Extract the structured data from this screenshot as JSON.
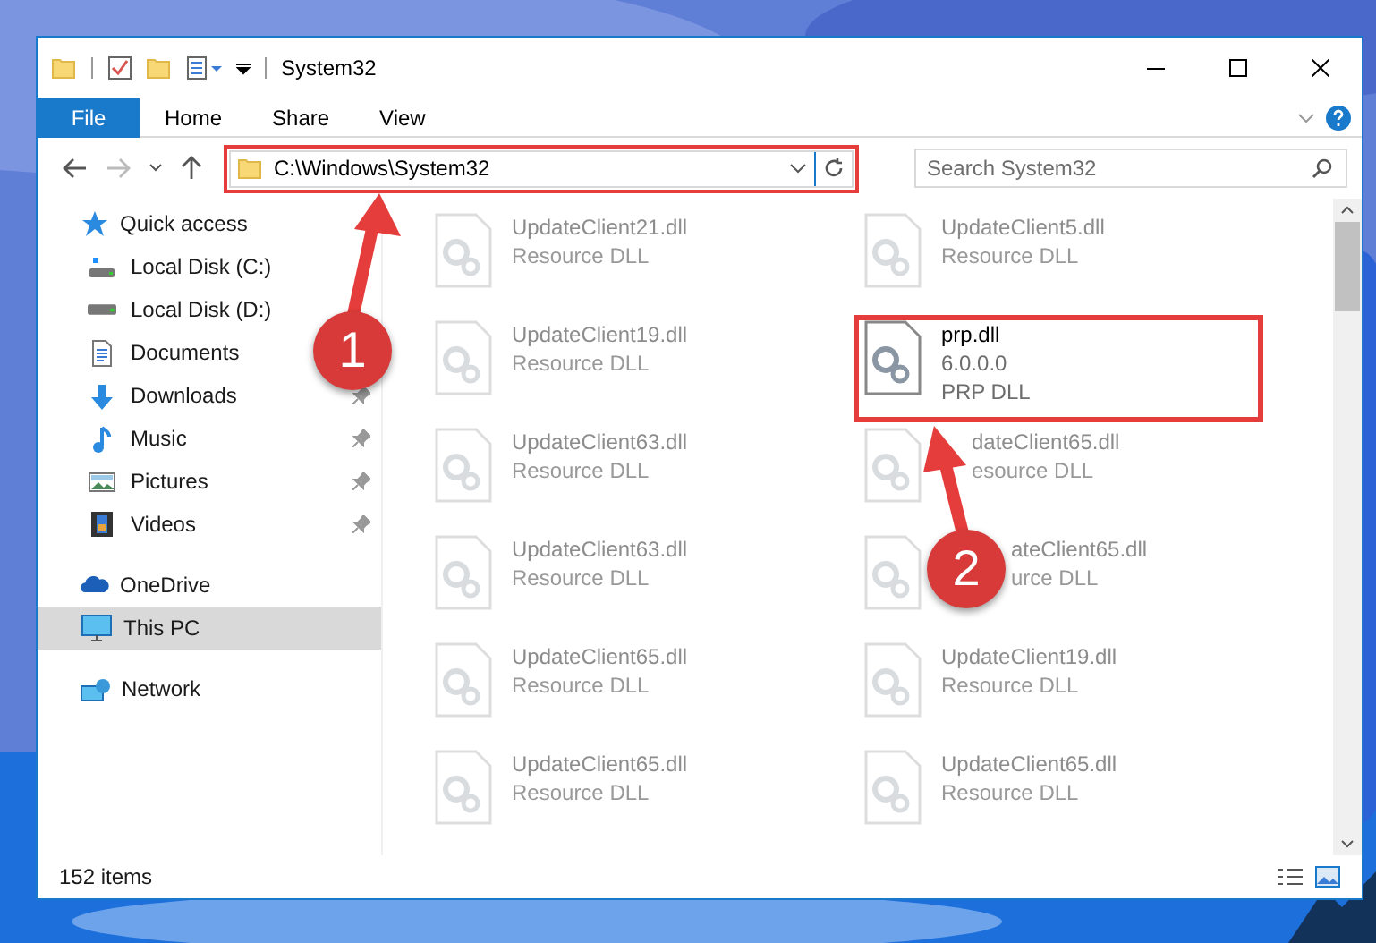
{
  "window": {
    "title": "System32"
  },
  "ribbon_tabs": [
    {
      "label": "File",
      "selected": true
    },
    {
      "label": "Home",
      "selected": false
    },
    {
      "label": "Share",
      "selected": false
    },
    {
      "label": "View",
      "selected": false
    }
  ],
  "address_bar": {
    "path": "C:\\Windows\\System32"
  },
  "search": {
    "placeholder": "Search System32"
  },
  "navigation": [
    {
      "label": "Quick access",
      "selected": false,
      "children": [
        {
          "label": "Local Disk (C:)"
        },
        {
          "label": "Local Disk (D:)"
        },
        {
          "label": "Documents"
        },
        {
          "label": "Downloads",
          "pinned": true
        },
        {
          "label": "Music",
          "pinned": true
        },
        {
          "label": "Pictures",
          "pinned": true
        },
        {
          "label": "Videos",
          "pinned": true
        }
      ]
    },
    {
      "label": "OneDrive",
      "selected": false
    },
    {
      "label": "This PC",
      "selected": true
    },
    {
      "label": "Network",
      "selected": false
    }
  ],
  "files": [
    {
      "kind": "plain",
      "name": "UpdateClient21.dll",
      "details": [
        "Resource DLL"
      ],
      "highlighted": false
    },
    {
      "kind": "plain",
      "name": "UpdateClient5.dll",
      "details": [
        "Resource DLL"
      ],
      "highlighted": false
    },
    {
      "kind": "plain",
      "name": "UpdateClient19.dll",
      "details": [
        "Resource DLL"
      ],
      "highlighted": false
    },
    {
      "kind": "plain",
      "name": "prp.dll",
      "details": [
        "6.0.0.0",
        "PRP DLL"
      ],
      "highlighted": true
    },
    {
      "kind": "plain",
      "name": "UpdateClient63.dll",
      "details": [
        "Resource DLL"
      ],
      "highlighted": false
    },
    {
      "kind": "under_arrow",
      "name": "dateClient65.dll",
      "details": [
        "esource DLL"
      ],
      "highlighted": false
    },
    {
      "kind": "plain",
      "name": "UpdateClient63.dll",
      "details": [
        "Resource DLL"
      ],
      "highlighted": false
    },
    {
      "kind": "under_marker",
      "name": "ateClient65.dll",
      "details": [
        "urce DLL"
      ],
      "highlighted": false
    },
    {
      "kind": "plain",
      "name": "UpdateClient65.dll",
      "details": [
        "Resource DLL"
      ],
      "highlighted": false
    },
    {
      "kind": "plain",
      "name": "UpdateClient19.dll",
      "details": [
        "Resource DLL"
      ],
      "highlighted": false
    },
    {
      "kind": "plain",
      "name": "UpdateClient65.dll",
      "details": [
        "Resource DLL"
      ],
      "highlighted": false
    },
    {
      "kind": "plain",
      "name": "UpdateClient65.dll",
      "details": [
        "Resource DLL"
      ],
      "highlighted": false
    }
  ],
  "status_bar": {
    "item_count": "152 items"
  },
  "annotations": [
    {
      "label": "1"
    },
    {
      "label": "2"
    }
  ]
}
